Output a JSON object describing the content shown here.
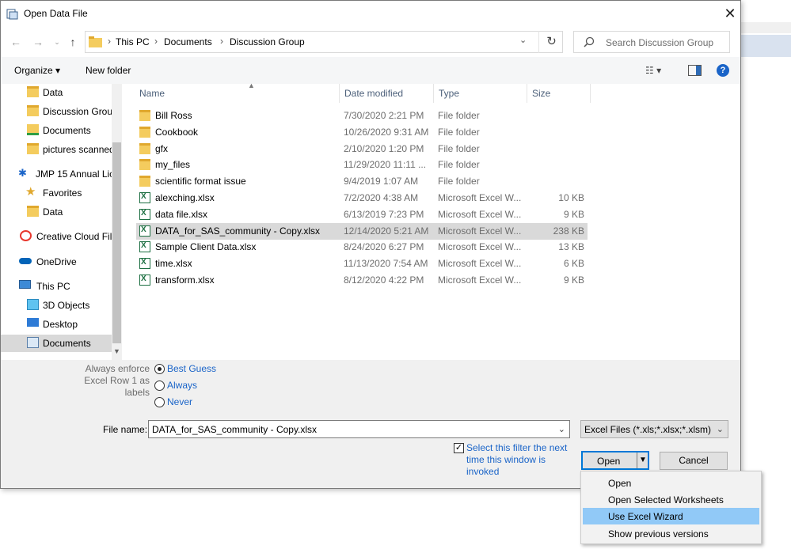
{
  "window": {
    "title": "Open Data File"
  },
  "address": {
    "crumbs": [
      "This PC",
      "Documents",
      "Discussion Group"
    ]
  },
  "search": {
    "placeholder": "Search Discussion Group"
  },
  "toolbar": {
    "organize": "Organize ▾",
    "new_folder": "New folder"
  },
  "nav": {
    "items": [
      {
        "label": "Data",
        "icon": "folder-icon"
      },
      {
        "label": "Discussion Grou",
        "icon": "folder-icon"
      },
      {
        "label": "Documents",
        "icon": "documents-icon"
      },
      {
        "label": "pictures scanned",
        "icon": "folder-icon"
      },
      {
        "label": "JMP 15 Annual Lic",
        "icon": "jmp-icon"
      },
      {
        "label": "Favorites",
        "icon": "star-icon"
      },
      {
        "label": "Data",
        "icon": "folder-icon"
      },
      {
        "label": "Creative Cloud Fil",
        "icon": "creative-cloud-icon"
      },
      {
        "label": "OneDrive",
        "icon": "cloud-icon"
      },
      {
        "label": "This PC",
        "icon": "computer-icon"
      },
      {
        "label": "3D Objects",
        "icon": "cube-icon"
      },
      {
        "label": "Desktop",
        "icon": "desktop-icon"
      },
      {
        "label": "Documents",
        "icon": "documents-icon"
      }
    ]
  },
  "columns": {
    "name": "Name",
    "date": "Date modified",
    "type": "Type",
    "size": "Size"
  },
  "files": [
    {
      "name": "Bill Ross",
      "date": "7/30/2020 2:21 PM",
      "type": "File folder",
      "size": "",
      "kind": "folder"
    },
    {
      "name": "Cookbook",
      "date": "10/26/2020 9:31 AM",
      "type": "File folder",
      "size": "",
      "kind": "folder"
    },
    {
      "name": "gfx",
      "date": "2/10/2020 1:20 PM",
      "type": "File folder",
      "size": "",
      "kind": "folder"
    },
    {
      "name": "my_files",
      "date": "11/29/2020 11:11 ...",
      "type": "File folder",
      "size": "",
      "kind": "folder"
    },
    {
      "name": "scientific format issue",
      "date": "9/4/2019 1:07 AM",
      "type": "File folder",
      "size": "",
      "kind": "folder"
    },
    {
      "name": "alexching.xlsx",
      "date": "7/2/2020 4:38 AM",
      "type": "Microsoft Excel W...",
      "size": "10 KB",
      "kind": "xls"
    },
    {
      "name": "data file.xlsx",
      "date": "6/13/2019 7:23 PM",
      "type": "Microsoft Excel W...",
      "size": "9 KB",
      "kind": "xls"
    },
    {
      "name": "DATA_for_SAS_community - Copy.xlsx",
      "date": "12/14/2020 5:21 AM",
      "type": "Microsoft Excel W...",
      "size": "238 KB",
      "kind": "xls"
    },
    {
      "name": "Sample Client Data.xlsx",
      "date": "8/24/2020 6:27 PM",
      "type": "Microsoft Excel W...",
      "size": "13 KB",
      "kind": "xls"
    },
    {
      "name": "time.xlsx",
      "date": "11/13/2020 7:54 AM",
      "type": "Microsoft Excel W...",
      "size": "6 KB",
      "kind": "xls"
    },
    {
      "name": "transform.xlsx",
      "date": "8/12/2020 4:22 PM",
      "type": "Microsoft Excel W...",
      "size": "9 KB",
      "kind": "xls"
    }
  ],
  "options": {
    "label_line1": "Always enforce",
    "label_line2": "Excel Row 1 as",
    "label_line3": "labels",
    "radio_best": "Best Guess",
    "radio_always": "Always",
    "radio_never": "Never"
  },
  "filename": {
    "label": "File name:",
    "value": "DATA_for_SAS_community - Copy.xlsx"
  },
  "filter": {
    "value": "Excel Files  (*.xls;*.xlsx;*.xlsm)"
  },
  "checkbox": {
    "text": "Select this filter the next time this window is invoked"
  },
  "buttons": {
    "open": "Open",
    "cancel": "Cancel"
  },
  "menu": {
    "items": [
      "Open",
      "Open Selected Worksheets",
      "Use Excel Wizard",
      "Show previous versions"
    ]
  },
  "colors": {
    "accent": "#0078d7",
    "link": "#1a64c8",
    "highlight": "#91c9f7",
    "selection": "#d9d9d9"
  }
}
